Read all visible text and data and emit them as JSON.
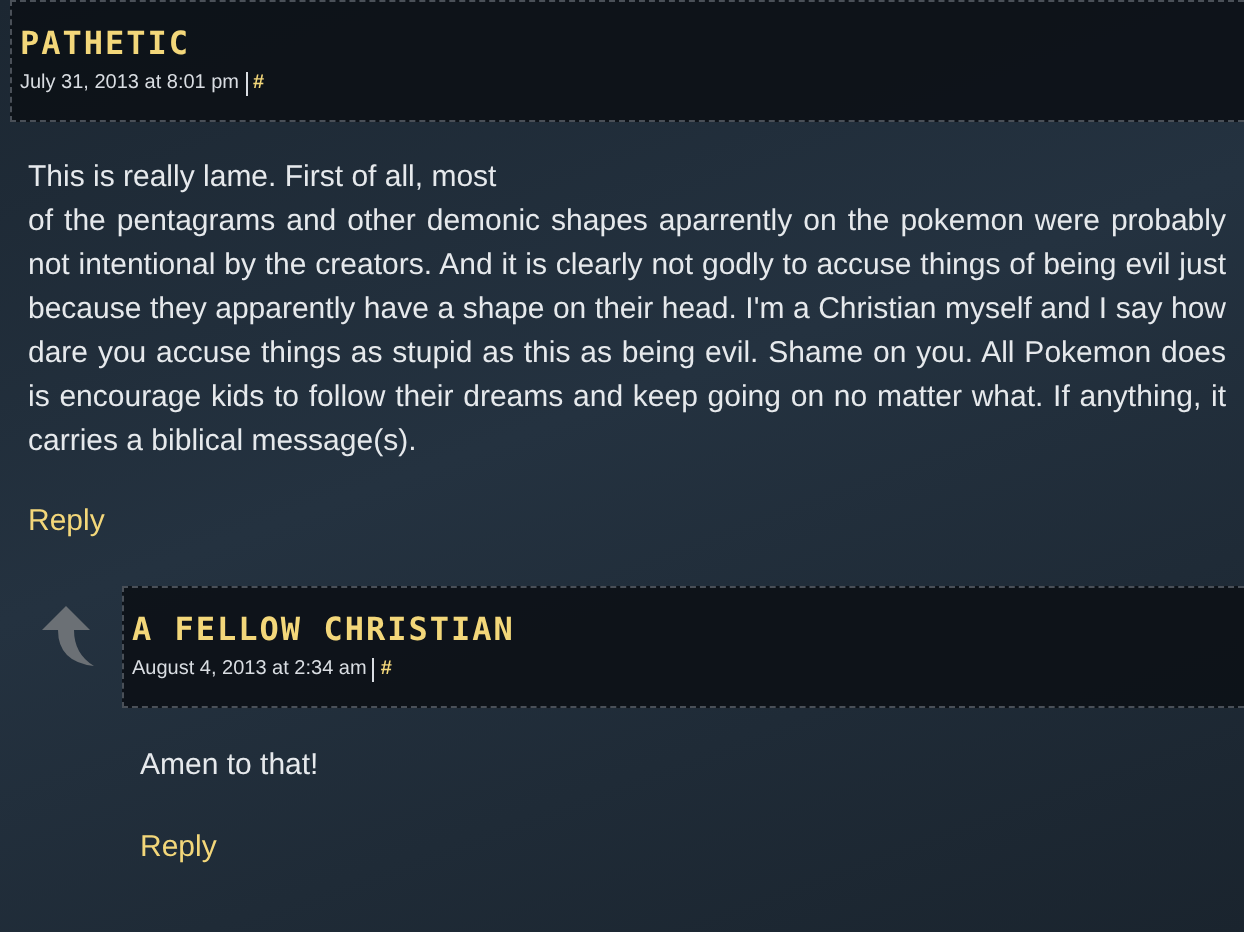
{
  "comments": [
    {
      "author": "PATHETIC",
      "date": "July 31, 2013 at 8:01 pm",
      "permalink": "#",
      "body": "This is really lame. First of all, most\nof the pentagrams and other demonic shapes aparrently on the pokemon were probably not intentional by the creators. And it is clearly not godly to accuse things of being evil just because they apparently have a shape on their head. I'm a Christian myself and I say how dare you accuse things as stupid as this as being evil. Shame on you. All Pokemon does is encourage kids to follow their dreams and keep going on no matter what. If anything, it carries a biblical message(s).",
      "reply": "Reply",
      "replies": [
        {
          "author": "A FELLOW CHRISTIAN",
          "date": "August 4, 2013 at 2:34 am",
          "permalink": "#",
          "body": "Amen to that!",
          "reply": "Reply"
        }
      ]
    }
  ]
}
